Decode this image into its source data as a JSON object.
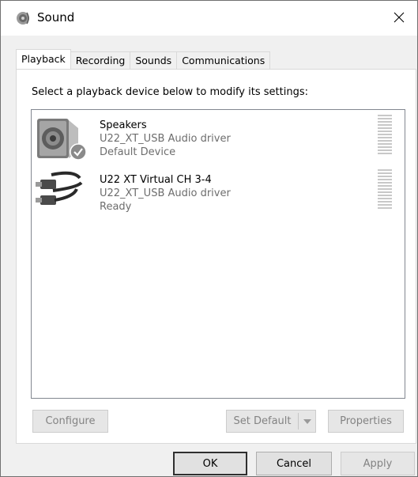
{
  "window": {
    "title": "Sound",
    "title_icon": "speaker-icon",
    "close_icon": "close-icon"
  },
  "tabs": [
    {
      "label": "Playback",
      "active": true
    },
    {
      "label": "Recording",
      "active": false
    },
    {
      "label": "Sounds",
      "active": false
    },
    {
      "label": "Communications",
      "active": false
    }
  ],
  "playback": {
    "instruction": "Select a playback device below to modify its settings:",
    "devices": [
      {
        "name": "Speakers",
        "driver": "U22_XT_USB Audio driver",
        "status": "Default Device",
        "icon": "speaker-icon",
        "badge": "checkmark-icon"
      },
      {
        "name": "U22 XT Virtual CH 3-4",
        "driver": "U22_XT_USB Audio driver",
        "status": "Ready",
        "icon": "rca-cable-icon"
      }
    ]
  },
  "buttons": {
    "configure": "Configure",
    "set_default": "Set Default",
    "properties": "Properties",
    "ok": "OK",
    "cancel": "Cancel",
    "apply": "Apply"
  }
}
